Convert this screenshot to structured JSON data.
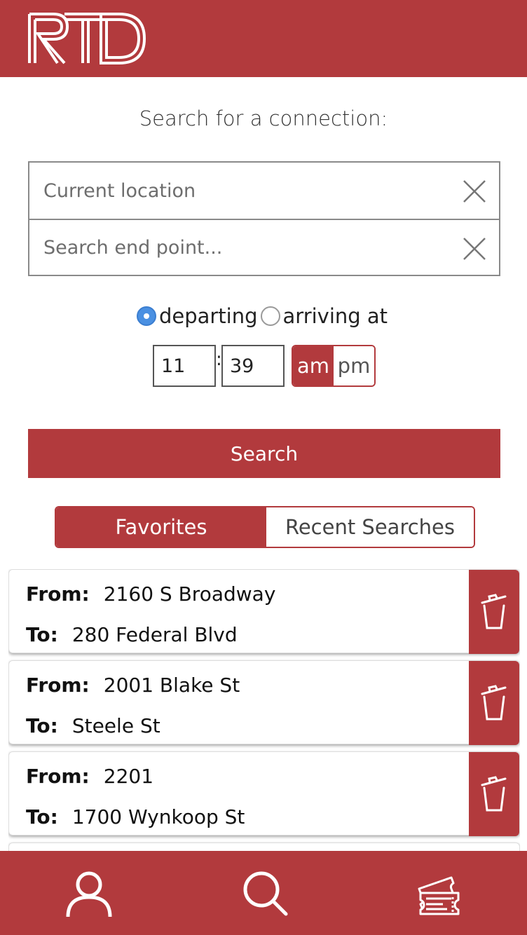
{
  "header": {
    "logo_text": "RTD"
  },
  "search": {
    "prompt": "Search for a connection:",
    "start_placeholder": "Current location",
    "end_placeholder": "Search end point...",
    "mode_departing": "departing",
    "mode_arriving": "arriving at",
    "selected_mode": "departing",
    "hour": "11",
    "minute": "39",
    "am_label": "am",
    "pm_label": "pm",
    "selected_period": "am",
    "button_label": "Search"
  },
  "tabs": {
    "favorites": "Favorites",
    "recent": "Recent Searches",
    "active": "favorites"
  },
  "favorites": [
    {
      "from_label": "From:",
      "from": "2160 S Broadway",
      "to_label": "To:",
      "to": "280 Federal Blvd"
    },
    {
      "from_label": "From:",
      "from": "2001 Blake St",
      "to_label": "To:",
      "to": "Steele St"
    },
    {
      "from_label": "From:",
      "from": "2201",
      "to_label": "To:",
      "to": "1700 Wynkoop St"
    }
  ],
  "footer": {
    "icons": [
      "user-icon",
      "search-icon",
      "ticket-icon"
    ]
  },
  "colors": {
    "brand": "#b23a3d",
    "radio_selected": "#4a90e2"
  }
}
